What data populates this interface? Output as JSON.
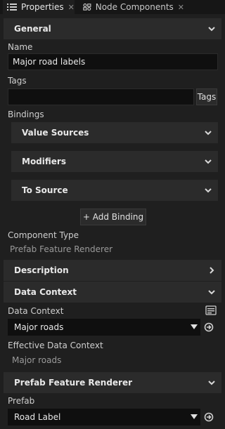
{
  "tabs": [
    {
      "label": "Properties",
      "icon": "list-icon",
      "active": true
    },
    {
      "label": "Node Components",
      "icon": "components-icon",
      "active": false
    }
  ],
  "sections": {
    "general": "General",
    "description": "Description",
    "data_context": "Data Context",
    "prefab_feature_renderer": "Prefab Feature Renderer"
  },
  "general": {
    "name_label": "Name",
    "name_value": "Major road labels",
    "tags_label": "Tags",
    "tags_value": "",
    "tags_button": "Tags",
    "bindings_label": "Bindings",
    "bindings": [
      "Value Sources",
      "Modifiers",
      "To Source"
    ],
    "add_binding": "+ Add Binding",
    "component_type_label": "Component Type",
    "component_type_value": "Prefab Feature Renderer"
  },
  "data_context": {
    "label": "Data Context",
    "value": "Major roads",
    "effective_label": "Effective Data Context",
    "effective_value": "Major roads"
  },
  "prefab": {
    "label": "Prefab",
    "value": "Road Label"
  },
  "colors": {
    "background": "#1f1f1f",
    "section_header": "#2b2b2b",
    "field": "#0f0f0f",
    "text": "#dcdcdc",
    "muted": "#9a9a9a"
  }
}
